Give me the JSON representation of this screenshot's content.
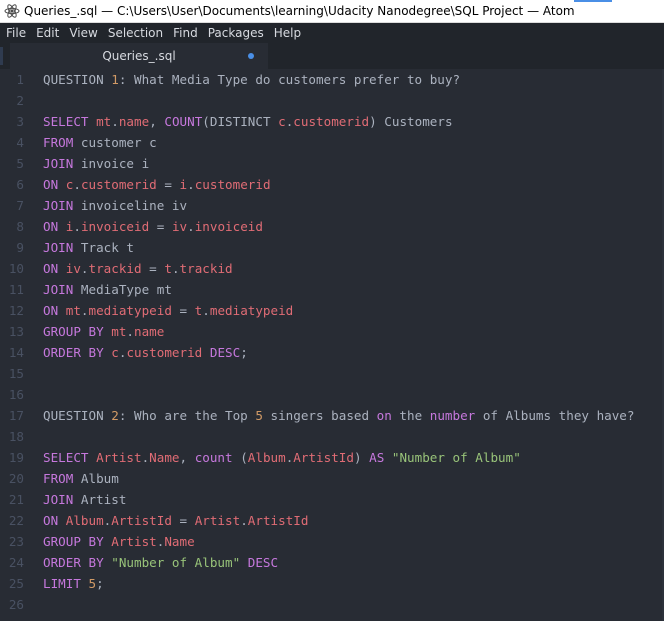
{
  "window": {
    "title": "Queries_.sql — C:\\Users\\User\\Documents\\learning\\Udacity Nanodegree\\SQL Project — Atom",
    "app_icon": "atom-icon"
  },
  "menu": [
    "File",
    "Edit",
    "View",
    "Selection",
    "Find",
    "Packages",
    "Help"
  ],
  "tab": {
    "label": "Queries_.sql",
    "modified": true
  },
  "colors": {
    "background": "#282c34",
    "keyword": "#c678dd",
    "identifier": "#e06c75",
    "number": "#d19a66",
    "string": "#98c379",
    "text": "#abb2bf"
  },
  "editor": {
    "lines": [
      {
        "n": "1",
        "tokens": [
          [
            "txt",
            "QUESTION "
          ],
          [
            "num",
            "1"
          ],
          [
            "txt",
            ": What Media Type do customers prefer to buy?"
          ]
        ]
      },
      {
        "n": "2",
        "tokens": []
      },
      {
        "n": "3",
        "tokens": [
          [
            "kw",
            "SELECT "
          ],
          [
            "id",
            "mt"
          ],
          [
            "txt",
            "."
          ],
          [
            "id",
            "name"
          ],
          [
            "txt",
            ", "
          ],
          [
            "kw",
            "COUNT"
          ],
          [
            "txt",
            "(DISTINCT "
          ],
          [
            "id",
            "c"
          ],
          [
            "txt",
            "."
          ],
          [
            "id",
            "customerid"
          ],
          [
            "txt",
            ") Customers"
          ]
        ]
      },
      {
        "n": "4",
        "tokens": [
          [
            "kw",
            "FROM "
          ],
          [
            "txt",
            "customer c"
          ]
        ]
      },
      {
        "n": "5",
        "tokens": [
          [
            "kw",
            "JOIN "
          ],
          [
            "txt",
            "invoice i"
          ]
        ]
      },
      {
        "n": "6",
        "tokens": [
          [
            "kw",
            "ON "
          ],
          [
            "id",
            "c"
          ],
          [
            "txt",
            "."
          ],
          [
            "id",
            "customerid"
          ],
          [
            "txt",
            " = "
          ],
          [
            "id",
            "i"
          ],
          [
            "txt",
            "."
          ],
          [
            "id",
            "customerid"
          ]
        ]
      },
      {
        "n": "7",
        "tokens": [
          [
            "kw",
            "JOIN "
          ],
          [
            "txt",
            "invoiceline iv"
          ]
        ]
      },
      {
        "n": "8",
        "tokens": [
          [
            "kw",
            "ON "
          ],
          [
            "id",
            "i"
          ],
          [
            "txt",
            "."
          ],
          [
            "id",
            "invoiceid"
          ],
          [
            "txt",
            " = "
          ],
          [
            "id",
            "iv"
          ],
          [
            "txt",
            "."
          ],
          [
            "id",
            "invoiceid"
          ]
        ]
      },
      {
        "n": "9",
        "tokens": [
          [
            "kw",
            "JOIN "
          ],
          [
            "txt",
            "Track t"
          ]
        ]
      },
      {
        "n": "10",
        "tokens": [
          [
            "kw",
            "ON "
          ],
          [
            "id",
            "iv"
          ],
          [
            "txt",
            "."
          ],
          [
            "id",
            "trackid"
          ],
          [
            "txt",
            " = "
          ],
          [
            "id",
            "t"
          ],
          [
            "txt",
            "."
          ],
          [
            "id",
            "trackid"
          ]
        ]
      },
      {
        "n": "11",
        "tokens": [
          [
            "kw",
            "JOIN "
          ],
          [
            "txt",
            "MediaType mt"
          ]
        ]
      },
      {
        "n": "12",
        "tokens": [
          [
            "kw",
            "ON "
          ],
          [
            "id",
            "mt"
          ],
          [
            "txt",
            "."
          ],
          [
            "id",
            "mediatypeid"
          ],
          [
            "txt",
            " = "
          ],
          [
            "id",
            "t"
          ],
          [
            "txt",
            "."
          ],
          [
            "id",
            "mediatypeid"
          ]
        ]
      },
      {
        "n": "13",
        "tokens": [
          [
            "kw",
            "GROUP BY "
          ],
          [
            "id",
            "mt"
          ],
          [
            "txt",
            "."
          ],
          [
            "id",
            "name"
          ]
        ]
      },
      {
        "n": "14",
        "tokens": [
          [
            "kw",
            "ORDER BY "
          ],
          [
            "id",
            "c"
          ],
          [
            "txt",
            "."
          ],
          [
            "id",
            "customerid"
          ],
          [
            "txt",
            " "
          ],
          [
            "kw",
            "DESC"
          ],
          [
            "txt",
            ";"
          ]
        ]
      },
      {
        "n": "15",
        "tokens": []
      },
      {
        "n": "16",
        "tokens": []
      },
      {
        "n": "17",
        "tokens": [
          [
            "txt",
            "QUESTION "
          ],
          [
            "num",
            "2"
          ],
          [
            "txt",
            ": Who are the Top "
          ],
          [
            "num",
            "5"
          ],
          [
            "txt",
            " singers based "
          ],
          [
            "kw",
            "on"
          ],
          [
            "txt",
            " the "
          ],
          [
            "kw",
            "number"
          ],
          [
            "txt",
            " of Albums they have?"
          ]
        ]
      },
      {
        "n": "18",
        "tokens": []
      },
      {
        "n": "19",
        "tokens": [
          [
            "kw",
            "SELECT "
          ],
          [
            "id",
            "Artist"
          ],
          [
            "txt",
            "."
          ],
          [
            "id",
            "Name"
          ],
          [
            "txt",
            ", "
          ],
          [
            "kw",
            "count"
          ],
          [
            "txt",
            " ("
          ],
          [
            "id",
            "Album"
          ],
          [
            "txt",
            "."
          ],
          [
            "id",
            "ArtistId"
          ],
          [
            "txt",
            ") "
          ],
          [
            "kw",
            "AS "
          ],
          [
            "str",
            "\"Number of Album\""
          ]
        ]
      },
      {
        "n": "20",
        "tokens": [
          [
            "kw",
            "FROM "
          ],
          [
            "txt",
            "Album"
          ]
        ]
      },
      {
        "n": "21",
        "tokens": [
          [
            "kw",
            "JOIN "
          ],
          [
            "txt",
            "Artist"
          ]
        ]
      },
      {
        "n": "22",
        "tokens": [
          [
            "kw",
            "ON "
          ],
          [
            "id",
            "Album"
          ],
          [
            "txt",
            "."
          ],
          [
            "id",
            "ArtistId"
          ],
          [
            "txt",
            " = "
          ],
          [
            "id",
            "Artist"
          ],
          [
            "txt",
            "."
          ],
          [
            "id",
            "ArtistId"
          ]
        ]
      },
      {
        "n": "23",
        "tokens": [
          [
            "kw",
            "GROUP BY "
          ],
          [
            "id",
            "Artist"
          ],
          [
            "txt",
            "."
          ],
          [
            "id",
            "Name"
          ]
        ]
      },
      {
        "n": "24",
        "tokens": [
          [
            "kw",
            "ORDER BY "
          ],
          [
            "str",
            "\"Number of Album\""
          ],
          [
            "txt",
            " "
          ],
          [
            "kw",
            "DESC"
          ]
        ]
      },
      {
        "n": "25",
        "tokens": [
          [
            "kw",
            "LIMIT "
          ],
          [
            "num",
            "5"
          ],
          [
            "txt",
            ";"
          ]
        ]
      },
      {
        "n": "26",
        "tokens": []
      }
    ]
  }
}
